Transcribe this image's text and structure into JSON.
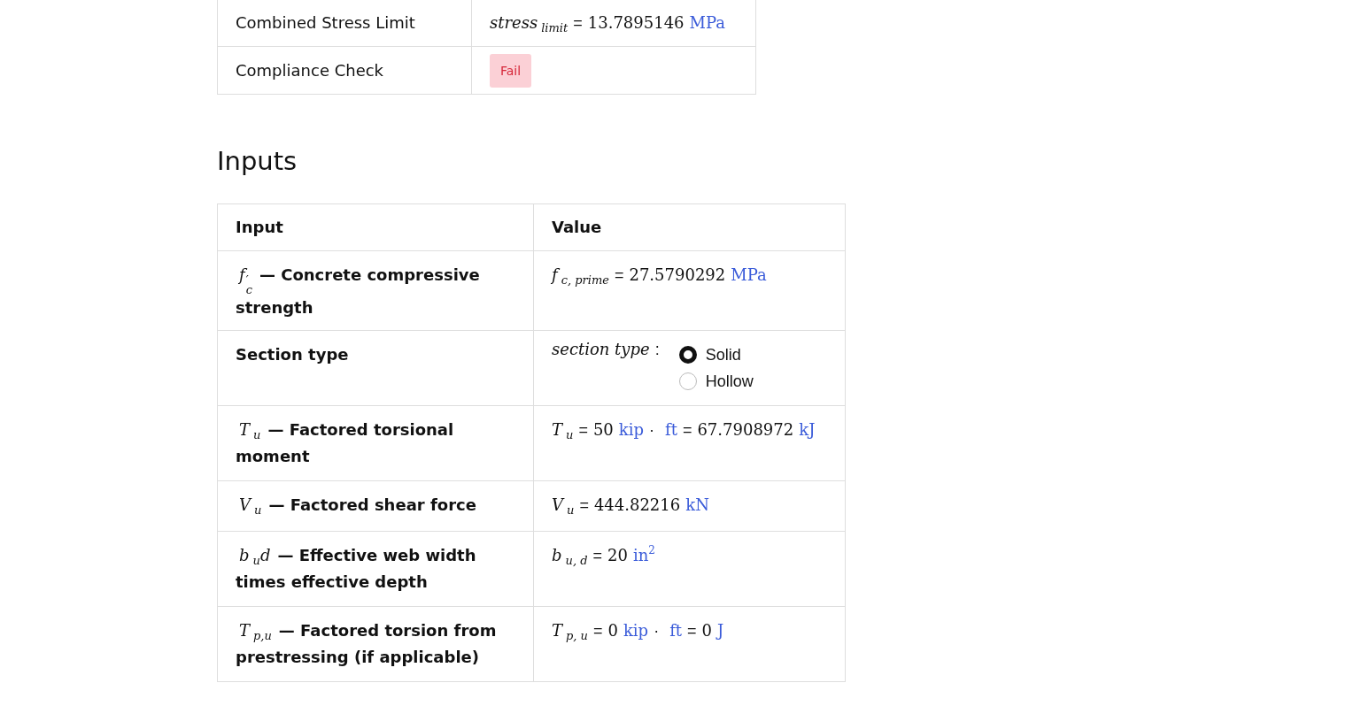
{
  "results_table": {
    "rows": [
      {
        "label": "Combined Stress Limit",
        "value": [
          {
            "kind": "var",
            "text": "stress"
          },
          {
            "kind": "sub",
            "text": "limit"
          },
          {
            "kind": "op",
            "text": "="
          },
          {
            "kind": "num",
            "text": "13.7895146"
          },
          {
            "kind": "unit",
            "text": "MPa"
          }
        ]
      },
      {
        "label": "Compliance Check",
        "badge": {
          "text": "Fail"
        }
      }
    ]
  },
  "inputs": {
    "heading": "Inputs",
    "columns": [
      "Input",
      "Value"
    ],
    "rows": [
      {
        "symbol": [
          {
            "kind": "var",
            "text": "f"
          },
          {
            "kind": "supsub",
            "sup": "′",
            "sub": "c"
          }
        ],
        "description": "— Concrete compressive strength",
        "value": [
          {
            "kind": "var",
            "text": "f"
          },
          {
            "kind": "sub",
            "text": "c, prime"
          },
          {
            "kind": "op",
            "text": "="
          },
          {
            "kind": "num",
            "text": "27.5790292"
          },
          {
            "kind": "unit",
            "text": "MPa"
          }
        ]
      },
      {
        "description": "Section type",
        "radio": {
          "label": "section type",
          "separator": ":",
          "options": [
            {
              "label": "Solid",
              "selected": true
            },
            {
              "label": "Hollow",
              "selected": false
            }
          ]
        }
      },
      {
        "symbol": [
          {
            "kind": "var",
            "text": "T"
          },
          {
            "kind": "sub",
            "text": "u"
          }
        ],
        "description": "— Factored torsional moment",
        "value": [
          {
            "kind": "var",
            "text": "T"
          },
          {
            "kind": "sub",
            "text": "u"
          },
          {
            "kind": "op",
            "text": "="
          },
          {
            "kind": "num",
            "text": "50"
          },
          {
            "kind": "unit",
            "text": "kip"
          },
          {
            "kind": "op",
            "text": "·"
          },
          {
            "kind": "unit",
            "text": "ft"
          },
          {
            "kind": "op",
            "text": "="
          },
          {
            "kind": "num",
            "text": "67.7908972"
          },
          {
            "kind": "unit",
            "text": "kJ"
          }
        ]
      },
      {
        "symbol": [
          {
            "kind": "var",
            "text": "V"
          },
          {
            "kind": "sub",
            "text": "u"
          }
        ],
        "description": "— Factored shear force",
        "value": [
          {
            "kind": "var",
            "text": "V"
          },
          {
            "kind": "sub",
            "text": "u"
          },
          {
            "kind": "op",
            "text": "="
          },
          {
            "kind": "num",
            "text": "444.82216"
          },
          {
            "kind": "unit",
            "text": "kN"
          }
        ]
      },
      {
        "symbol": [
          {
            "kind": "var",
            "text": "b"
          },
          {
            "kind": "sub",
            "text": "u"
          },
          {
            "kind": "var",
            "text": "d"
          }
        ],
        "description": "— Effective web width times effective depth",
        "value": [
          {
            "kind": "var",
            "text": "b"
          },
          {
            "kind": "sub",
            "text": "u, d"
          },
          {
            "kind": "op",
            "text": "="
          },
          {
            "kind": "num",
            "text": "20"
          },
          {
            "kind": "unit",
            "text": "in"
          },
          {
            "kind": "unitsup",
            "text": "2"
          }
        ]
      },
      {
        "symbol": [
          {
            "kind": "var",
            "text": "T"
          },
          {
            "kind": "sub",
            "text": "p,u"
          }
        ],
        "description": "— Factored torsion from prestressing (if applicable)",
        "value": [
          {
            "kind": "var",
            "text": "T"
          },
          {
            "kind": "sub",
            "text": "p, u"
          },
          {
            "kind": "op",
            "text": "="
          },
          {
            "kind": "num",
            "text": "0"
          },
          {
            "kind": "unit",
            "text": "kip"
          },
          {
            "kind": "op",
            "text": "·"
          },
          {
            "kind": "unit",
            "text": "ft"
          },
          {
            "kind": "op",
            "text": "="
          },
          {
            "kind": "num",
            "text": "0"
          },
          {
            "kind": "unit",
            "text": "J"
          }
        ]
      }
    ]
  }
}
